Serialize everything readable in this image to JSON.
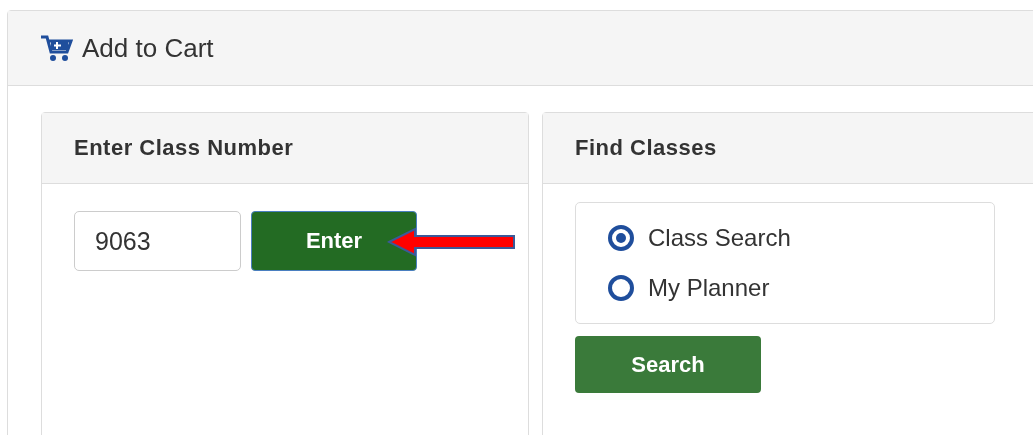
{
  "panel": {
    "title": "Add to Cart"
  },
  "class_number": {
    "title": "Enter Class Number",
    "value": "9063",
    "button": "Enter"
  },
  "find_classes": {
    "title": "Find Classes",
    "options": [
      {
        "label": "Class Search",
        "selected": true
      },
      {
        "label": "My Planner",
        "selected": false
      }
    ],
    "button": "Search"
  }
}
